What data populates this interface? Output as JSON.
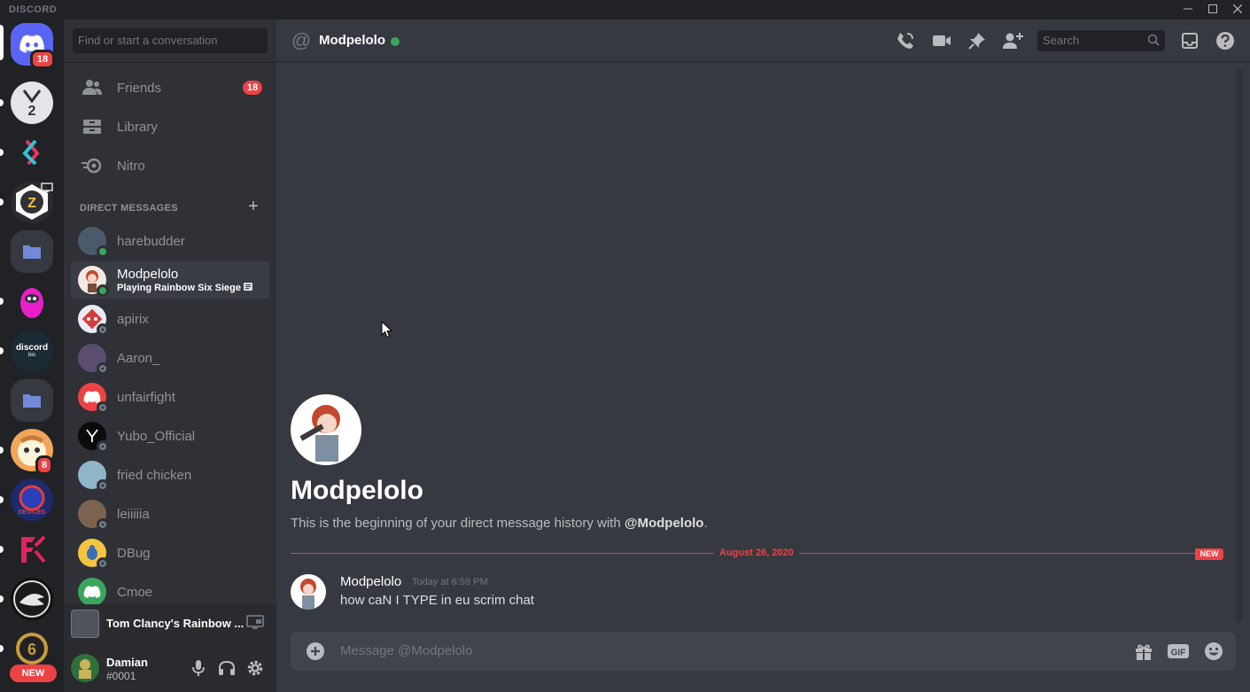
{
  "app": {
    "brand": "DISCORD"
  },
  "colors": {
    "accent": "#5865f2",
    "online": "#3ba55d",
    "alert": "#ed4245",
    "background": "#36393f",
    "sidebar": "#2f3136"
  },
  "servers": {
    "home_badge": "18",
    "badge_8": "8",
    "discordbio_label": "discord",
    "discordbio_sub": "bio",
    "new_label": "NEW"
  },
  "sidebar": {
    "search_placeholder": "Find or start a conversation",
    "nav": [
      {
        "label": "Friends",
        "icon": "friends-icon",
        "badge": "18"
      },
      {
        "label": "Library",
        "icon": "library-icon"
      },
      {
        "label": "Nitro",
        "icon": "nitro-icon"
      }
    ],
    "dm_header": "DIRECT MESSAGES",
    "dm_plus": "+",
    "dms": [
      {
        "name": "harebudder",
        "status": "online"
      },
      {
        "name": "Modpelolo",
        "status": "online",
        "activity": "Playing Rainbow Six Siege"
      },
      {
        "name": "apirix",
        "status": "offline"
      },
      {
        "name": "Aaron_",
        "status": "offline"
      },
      {
        "name": "unfairfight",
        "status": "offline"
      },
      {
        "name": "Yubo_Official",
        "status": "offline"
      },
      {
        "name": "fried chicken",
        "status": "offline"
      },
      {
        "name": "leiiiiia",
        "status": "offline"
      },
      {
        "name": "DBug",
        "status": "offline"
      },
      {
        "name": "Cmoe",
        "status": "offline"
      }
    ],
    "activity_game": "Tom Clancy's Rainbow ...",
    "user": {
      "name": "Damian",
      "tag": "#0001"
    }
  },
  "header": {
    "at_symbol": "@",
    "name": "Modpelolo",
    "search_placeholder": "Search"
  },
  "chat": {
    "welcome_name": "Modpelolo",
    "welcome_prefix": "This is the beginning of your direct message history with ",
    "welcome_handle": "@Modpelolo",
    "welcome_suffix": ".",
    "divider_date": "August 26, 2020",
    "divider_new": "NEW",
    "message": {
      "author": "Modpelolo",
      "time": "Today at 6:59 PM",
      "text": "how caN I TYPE in eu scrim chat"
    },
    "composer_placeholder": "Message @Modpelolo",
    "gif_label": "GIF"
  }
}
